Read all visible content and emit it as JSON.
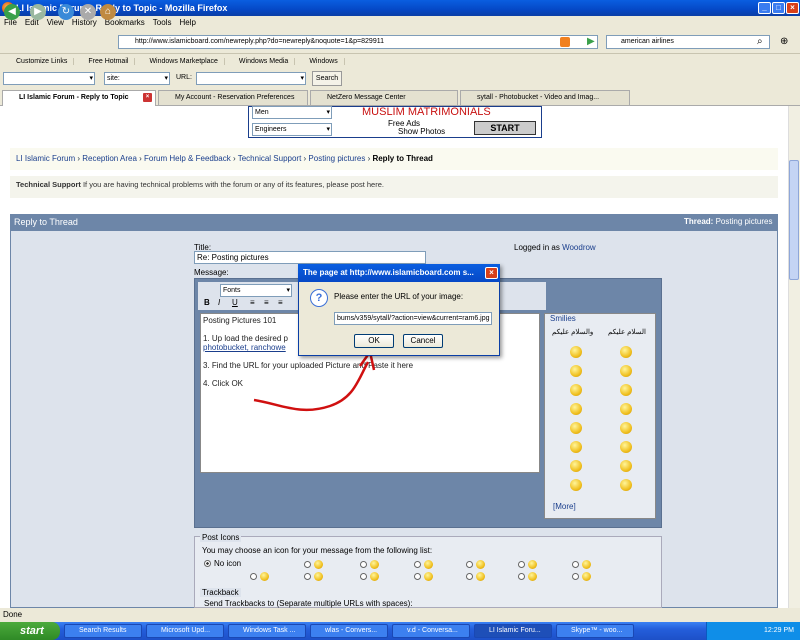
{
  "window": {
    "title": "LI Islamic Forum - Reply to Topic - Mozilla Firefox"
  },
  "menu": [
    "File",
    "Edit",
    "View",
    "History",
    "Bookmarks",
    "Tools",
    "Help"
  ],
  "address": {
    "url": "http://www.islamicboard.com/newreply.php?do=newreply&noquote=1&p=829911"
  },
  "search": {
    "value": "american airlines"
  },
  "bookmarks": [
    "Customize Links",
    "Free Hotmail",
    "Windows Marketplace",
    "Windows Media",
    "Windows"
  ],
  "toolbar2": {
    "site_value": "site:",
    "url_label": "URL:",
    "search_button": "Search"
  },
  "tabs": [
    "LI Islamic Forum - Reply to Topic",
    "My Account - Reservation Preferences",
    "NetZero Message Center",
    "sytall - Photobucket - Video and Imag..."
  ],
  "banner": {
    "select1": "Men",
    "select2": "Engineers",
    "title": "MUSLIM MATRIMONIALS",
    "opt1": "Free Ads",
    "opt2": "Show Photos",
    "button": "START"
  },
  "breadcrumb": {
    "items": [
      "LI Islamic Forum",
      "Reception Area",
      "Forum Help & Feedback",
      "Technical Support",
      "Posting pictures"
    ],
    "current": "Reply to Thread"
  },
  "forum_info": {
    "name": "Technical Support",
    "text": "If you are having technical problems with the forum or any of its features, please post here."
  },
  "reply": {
    "header": "Reply to Thread",
    "thread_label": "Thread:",
    "thread_name": "Posting pictures",
    "title_label": "Title:",
    "title_value": "Re: Posting pictures",
    "logged_label": "Logged in as",
    "logged_user": "Woodrow",
    "message_label": "Message:"
  },
  "editor": {
    "font": "Fonts",
    "lines": [
      "Posting Pictures 101",
      "1. Up load the desired p",
      "photobucket, ranchowe",
      "3. Find the URL for your uploaded Picture and Paste it here",
      "4. Click OK"
    ]
  },
  "smilies": {
    "title": "Smilies",
    "col1": "السلام عليكم",
    "col2": "والسلام عليكم",
    "more": "[More]"
  },
  "dialog": {
    "title": "The page at http://www.islamicboard.com s...",
    "prompt": "Please enter the URL of your image:",
    "value": "bums/v359/sytall/?action=view&current=ram6.jpg",
    "ok": "OK",
    "cancel": "Cancel"
  },
  "post_icons": {
    "title": "Post Icons",
    "text": "You may choose an icon for your message from the following list:",
    "no_icon": "No icon"
  },
  "trackback": {
    "title": "Trackback",
    "text": "Send Trackbacks to (Separate multiple URLs with spaces):"
  },
  "status": {
    "text": "Done"
  },
  "taskbar": {
    "start": "start",
    "items": [
      "Search Results",
      "Microsoft Upd...",
      "Windows Task ...",
      "wlas - Convers...",
      "v.d - Conversa...",
      "LI Islamic Foru...",
      "Skype™ - woo..."
    ],
    "time": "12:29 PM"
  },
  "colors": {
    "accent": "#6d86a8",
    "annotation": "#d01010"
  }
}
